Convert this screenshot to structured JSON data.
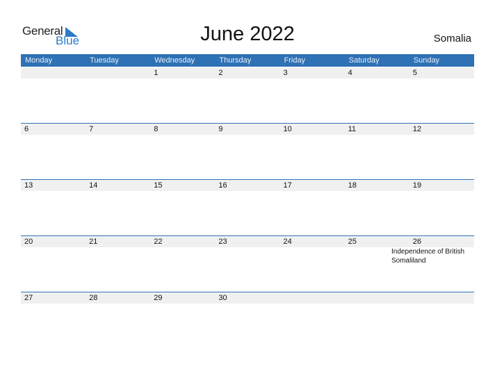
{
  "logo": {
    "general": "General",
    "blue": "Blue"
  },
  "title": "June 2022",
  "country": "Somalia",
  "weekdays": [
    "Monday",
    "Tuesday",
    "Wednesday",
    "Thursday",
    "Friday",
    "Saturday",
    "Sunday"
  ],
  "weeks": [
    [
      "",
      "",
      "1",
      "2",
      "3",
      "4",
      "5"
    ],
    [
      "6",
      "7",
      "8",
      "9",
      "10",
      "11",
      "12"
    ],
    [
      "13",
      "14",
      "15",
      "16",
      "17",
      "18",
      "19"
    ],
    [
      "20",
      "21",
      "22",
      "23",
      "24",
      "25",
      "26"
    ],
    [
      "27",
      "28",
      "29",
      "30",
      "",
      "",
      ""
    ]
  ],
  "holidays": [
    {
      "date": "26",
      "name": "Independence of British Somaliland"
    }
  ]
}
